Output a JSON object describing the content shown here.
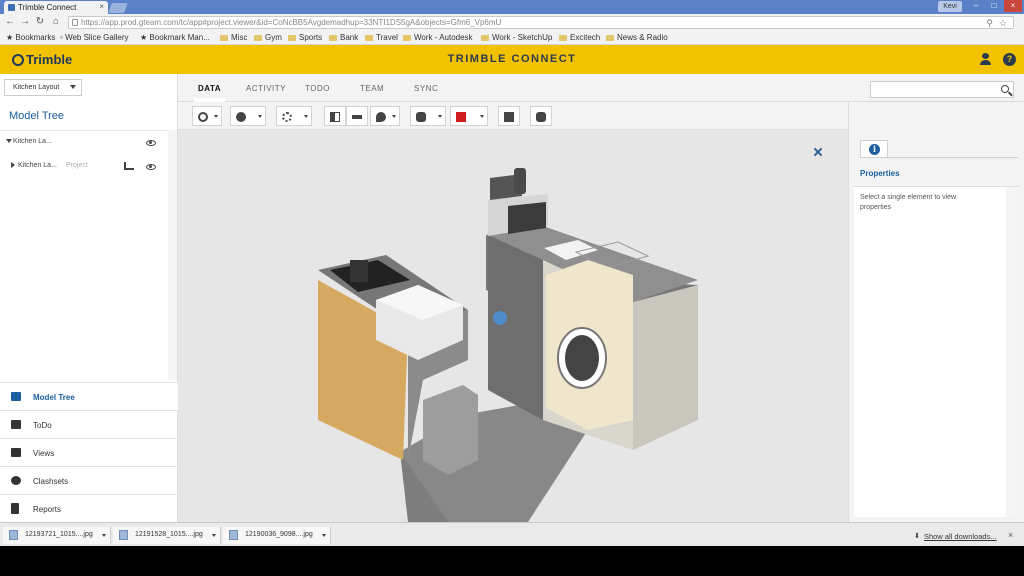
{
  "browser": {
    "tab_title": "Trimble Connect",
    "url": "https://app.prod.gteam.com/tc/app#project.viewer&id=CoNcBB5Avgdemadhup=33NTI1DS5gA&objects=Gfm6_Vp6mU",
    "user_label": "Kevi",
    "bookmarks": [
      "Bookmarks",
      "Web Slice Gallery",
      "Bookmark Man...",
      "Misc",
      "Gym",
      "Sports",
      "Bank",
      "Travel",
      "Work - Autodesk",
      "Work - SketchUp",
      "Excitech",
      "News & Radio"
    ]
  },
  "header": {
    "logo_text": "Trimble",
    "title": "TRIMBLE CONNECT"
  },
  "sidebar": {
    "project_selector": "Kitchen Layout",
    "model_tree_title": "Model Tree",
    "tree": [
      {
        "label": "Kitchen La...",
        "sublabel": ""
      },
      {
        "label": "Kitchen La...",
        "sublabel": "Project"
      }
    ],
    "nav": [
      {
        "label": "Model Tree",
        "active": true
      },
      {
        "label": "ToDo",
        "active": false
      },
      {
        "label": "Views",
        "active": false
      },
      {
        "label": "Clashsets",
        "active": false
      },
      {
        "label": "Reports",
        "active": false
      }
    ]
  },
  "main": {
    "tabs": [
      "DATA",
      "ACTIVITY",
      "TODO",
      "TEAM",
      "SYNC"
    ],
    "active_tab": "DATA",
    "search_placeholder": ""
  },
  "properties": {
    "title": "Properties",
    "message": "Select a single element to view properties"
  },
  "downloads": {
    "items": [
      "12193721_1015....jpg",
      "12191528_1015....jpg",
      "12190036_9098....jpg"
    ],
    "show_all": "Show all downloads..."
  },
  "colors": {
    "brand_yellow": "#f2c100",
    "accent_blue": "#1c5ea0"
  }
}
